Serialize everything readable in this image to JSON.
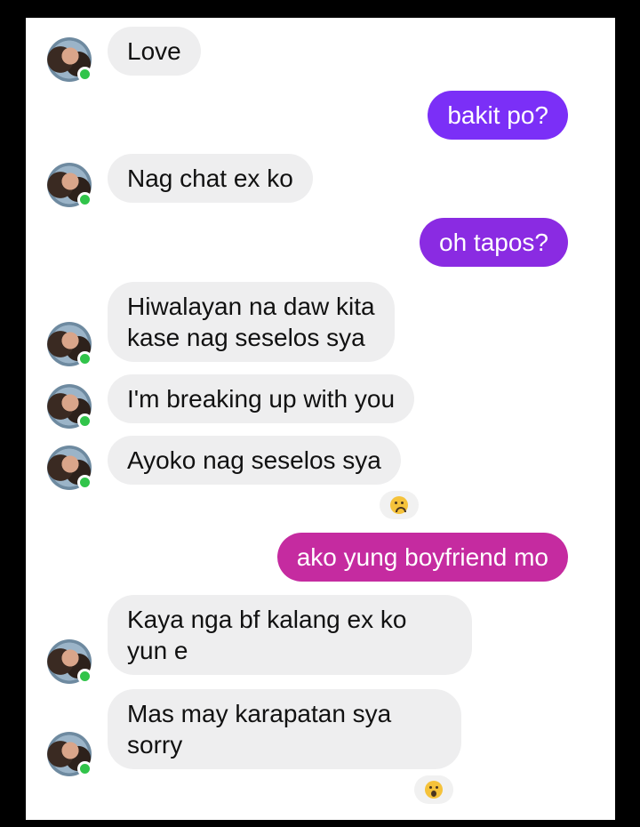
{
  "colors": {
    "incoming_bg": "#eeeeef",
    "outgoing_purple_1": "#7b2ff7",
    "outgoing_purple_2": "#8a2be2",
    "outgoing_magenta": "#c52ba0",
    "online_dot": "#31c44a"
  },
  "messages": [
    {
      "from": "them",
      "text": "Love"
    },
    {
      "from": "me",
      "text": "bakit po?"
    },
    {
      "from": "them",
      "text": "Nag chat ex ko"
    },
    {
      "from": "me",
      "text": "oh tapos?"
    },
    {
      "from": "them",
      "lines": [
        "Hiwalayan na daw kita",
        "kase nag seselos sya"
      ]
    },
    {
      "from": "them",
      "text": "I'm breaking up with you"
    },
    {
      "from": "them",
      "text": "Ayoko nag seselos sya",
      "reaction": "sad-face-emoji"
    },
    {
      "from": "me",
      "text": "ako yung boyfriend mo"
    },
    {
      "from": "them",
      "lines": [
        "Kaya nga bf kalang ex ko",
        "yun e"
      ]
    },
    {
      "from": "them",
      "lines": [
        "Mas may karapatan sya",
        "sorry"
      ],
      "reaction": "surprised-face-emoji"
    }
  ]
}
